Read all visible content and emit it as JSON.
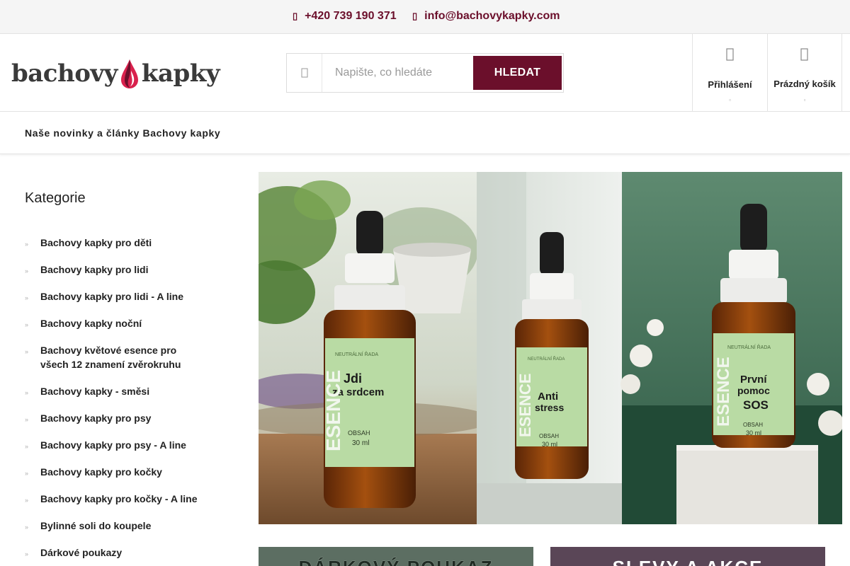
{
  "topbar": {
    "phone": "+420 739 190 371",
    "email": "info@bachovykapky.com",
    "phone_icon": "phone-icon",
    "email_icon": "envelope-icon"
  },
  "header": {
    "logo_left": "bachovy",
    "logo_right": "kapky",
    "search": {
      "placeholder": "Napište, co hledáte",
      "button_label": "HLEDAT"
    },
    "login_label": "Přihlášení",
    "cart_label": "Prázdný košík"
  },
  "nav": {
    "items": [
      "Naše novinky a články Bachovy kapky"
    ]
  },
  "sidebar": {
    "title": "Kategorie",
    "categories": [
      "Bachovy kapky pro děti",
      "Bachovy kapky pro lidi",
      "Bachovy kapky pro lidi - A line",
      "Bachovy kapky noční",
      "Bachovy květové esence pro všech 12 znamení zvěrokruhu",
      "Bachovy kapky - směsi",
      "Bachovy kapky pro psy",
      "Bachovy kapky pro psy - A line",
      "Bachovy kapky pro kočky",
      "Bachovy kapky pro kočky - A line",
      "Bylinné soli do koupele",
      "Dárkové poukazy"
    ]
  },
  "banner": {
    "products": [
      {
        "series": "NEUTRÁLNÍ ŘADA",
        "name_line1": "Jdi",
        "name_line2": "za srdcem",
        "brand": "ESENCE",
        "content": "OBSAH",
        "volume": "30 ml"
      },
      {
        "series": "NEUTRÁLNÍ ŘADA",
        "name_line1": "Anti",
        "name_line2": "stress",
        "brand": "ESENCE",
        "content": "OBSAH",
        "volume": "30 ml"
      },
      {
        "series": "NEUTRÁLNÍ ŘADA",
        "name_line1": "První",
        "name_line2": "pomoc",
        "name_line3": "SOS",
        "brand": "ESENCE",
        "content": "OBSAH",
        "volume": "30 ml"
      }
    ]
  },
  "promos": [
    {
      "label": "DÁRKOVÝ POUKAZ"
    },
    {
      "label": "SLEVY A AKCE"
    }
  ],
  "colors": {
    "brand": "#6b0f2b",
    "label_green": "#b9dba4",
    "bottle_amber": "#8a3d0c"
  }
}
